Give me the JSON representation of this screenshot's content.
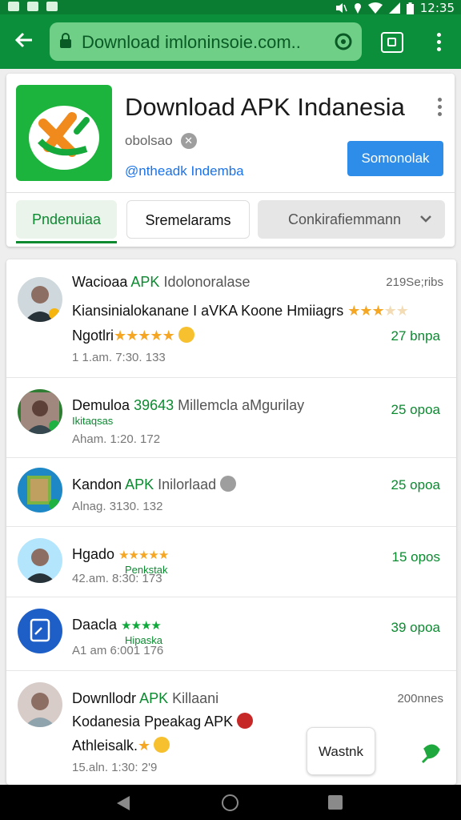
{
  "status_bar": {
    "time": "12:35",
    "icons": [
      "notification-icon",
      "notification-icon",
      "notification-icon",
      "mute-icon",
      "location-icon",
      "wifi-icon",
      "signal-icon",
      "battery-icon"
    ]
  },
  "toolbar": {
    "url": "Download imloninsoie.com..",
    "color": "#0c8f3a"
  },
  "app": {
    "title": "Download APK Indanesia",
    "developer": "obolsao",
    "link": "@ntheadk Indemba",
    "install_label": "Somonolak"
  },
  "chips": [
    "Pndenuiaa",
    "Sremelarams",
    "Conkirafiemmann"
  ],
  "list": [
    {
      "name": "Wacioaa",
      "green_tag": "APK",
      "rest": "Idolonoralase",
      "right_top": "219Se;ribs",
      "line2": "Kiansinialokanane I аVKA Koone Hmiiagrs",
      "line3": "Ngotlri",
      "right_value": "27 bnpa",
      "timestamp": "1 1.am. 7:30. 133"
    },
    {
      "name": "Demuloa",
      "green_tag": "39643",
      "rest": "Millemcla aMgurilay",
      "tag": "Ikitaqsas",
      "right_value": "25 opoa",
      "timestamp": "Aham. 1:20. 172"
    },
    {
      "name": "Kandon",
      "green_tag": "APK",
      "rest": "Inilorlaad",
      "right_value": "25 opoa",
      "timestamp": "Alnag. 3130. 132"
    },
    {
      "name": "Hgado",
      "tag": "Penkstak",
      "right_value": "15 opos",
      "timestamp": "42.am. 8:30: 173"
    },
    {
      "name": "Daacla",
      "tag": "Hipaska",
      "right_value": "39 opoa",
      "timestamp": "A1 am  6:001 176"
    },
    {
      "name": "Downllodr",
      "green_tag": "APK",
      "rest": "Killaani",
      "right_top": "200nnes",
      "line2": "Kodanesia Ppeakag APK",
      "line3": "Athleisalk.",
      "timestamp": "15.aln. 1:30:  2'9"
    }
  ],
  "floating_button": "Wastnk",
  "accent_green": "#0b8a30",
  "accent_blue": "#2e8de8"
}
